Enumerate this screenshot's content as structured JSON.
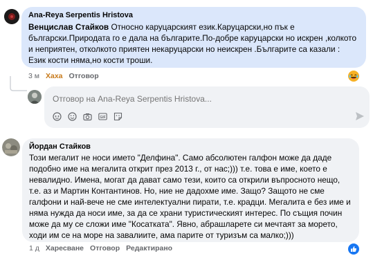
{
  "comment1": {
    "author": "Ana-Reya Serpentis Hristova",
    "text_bold": "Венцислав Стайков",
    "text": " Относно каруцарският език.Каруцарски,но пък е български.Природата го е дала на българите.По-добре каруцарски но искрен ,колкото и неприятен, отколкото приятен некаруцарски но неискрен .Българите са казали : Език кости няма,но кости троши.",
    "time": "3 м",
    "reaction_label": "Хаха",
    "reply_label": "Отговор",
    "reaction_icon": "laughing-emoji-icon"
  },
  "reply_box": {
    "placeholder": "Отговор на Ana-Reya Serpentis Hristova...",
    "tools": [
      "avatar-sticker-icon",
      "emoji-icon",
      "camera-icon",
      "gif-icon",
      "sticker-icon"
    ],
    "send_icon": "send-icon"
  },
  "comment2": {
    "author": "Йордан Стайков",
    "text": "Този мегалит не носи името \"Делфина\". Само абсолютен галфон може да даде подобно име на мегалита открит през 2013 г., от нас;))) т.е. това е име, което е невалидно. Имена, могат да дават само тези, които са открили въпросното нещо, т.е. аз и Мартин Контантинов. Но, ние не дадохме име. Защо? Защото не сме галфони и най-вече не сме интелектуални пирати, т.е. крадци. Мегалита е без име и няма нужда да носи име, за да се храни туристическият интерес. По същия почин може да му се сложи име \"Косатката\". Явно, абрашларете си мечтаят за морето, ходи им се на море на завалиите, ама парите от туризъм са малко;)))",
    "time": "1 д",
    "like_label": "Харесване",
    "reply_label": "Отговор",
    "edited_label": "Редактирано",
    "reaction_icon": "like-thumb-icon"
  },
  "colors": {
    "highlight_bubble": "#dbe7fb",
    "comment_bubble": "#f0f2f5",
    "like_blue": "#1877f2",
    "meta_gray": "#65676b"
  }
}
